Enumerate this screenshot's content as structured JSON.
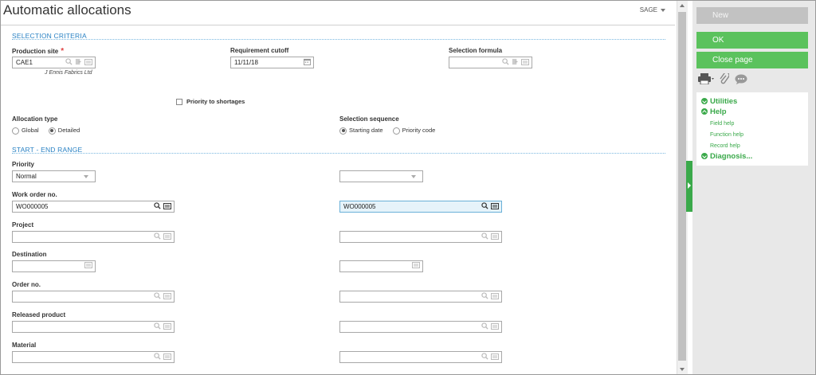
{
  "window": {
    "title": "Automatic allocations",
    "company": "SAGE"
  },
  "sections": {
    "criteria": "SELECTION CRITERIA",
    "range": "START - END RANGE"
  },
  "criteria": {
    "production_site": {
      "label": "Production site",
      "value": "CAE1",
      "sub": "J Ennis Fabrics Ltd"
    },
    "requirement_cutoff": {
      "label": "Requirement cutoff",
      "value": "11/11/18"
    },
    "selection_formula": {
      "label": "Selection formula",
      "value": ""
    },
    "priority_to_shortages": {
      "label": "Priority to shortages",
      "checked": false
    },
    "allocation_type": {
      "label": "Allocation type",
      "options": [
        "Global",
        "Detailed"
      ],
      "selected": "Detailed"
    },
    "selection_sequence": {
      "label": "Selection sequence",
      "options": [
        "Starting date",
        "Priority code"
      ],
      "selected": "Starting date"
    }
  },
  "range": {
    "priority": {
      "label": "Priority",
      "start": "Normal",
      "end": ""
    },
    "work_order": {
      "label": "Work order no.",
      "start": "WO000005",
      "end": "WO000005"
    },
    "project": {
      "label": "Project",
      "start": "",
      "end": ""
    },
    "destination": {
      "label": "Destination",
      "start": "",
      "end": ""
    },
    "order_no": {
      "label": "Order no.",
      "start": "",
      "end": ""
    },
    "released_product": {
      "label": "Released product",
      "start": "",
      "end": ""
    },
    "material": {
      "label": "Material",
      "start": "",
      "end": ""
    }
  },
  "actions": {
    "new": "New",
    "ok": "OK",
    "close": "Close page"
  },
  "panel": {
    "utilities": "Utilities",
    "help": "Help",
    "links": [
      "Field help",
      "Function help",
      "Record help"
    ],
    "diagnosis": "Diagnosis..."
  },
  "colors": {
    "accent_green": "#5bc25d",
    "section_blue": "#2a82c4",
    "focus_bg": "#e6f3fa"
  }
}
